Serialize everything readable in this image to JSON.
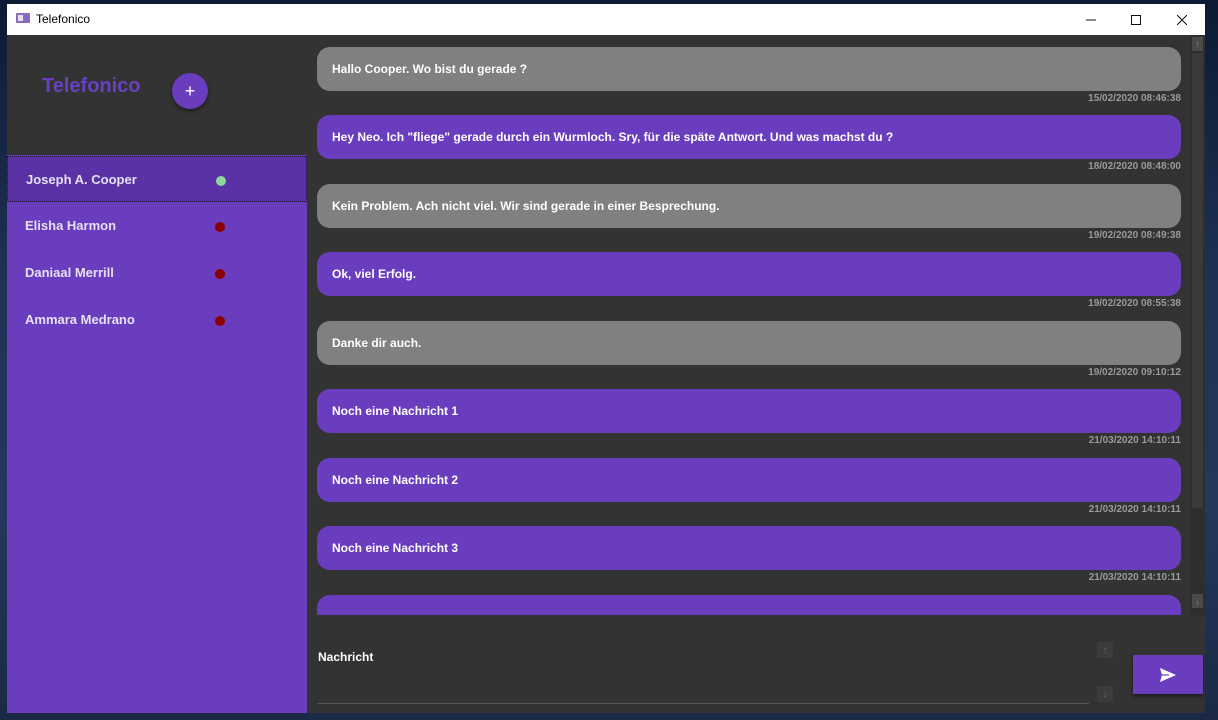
{
  "window": {
    "title": "Telefonico"
  },
  "sidebar": {
    "brand": "Telefonico",
    "add_label": "+",
    "contacts": [
      {
        "name": "Joseph A. Cooper",
        "status": "online",
        "status_color": "#8fd69a"
      },
      {
        "name": "Elisha Harmon",
        "status": "offline",
        "status_color": "#8b0000"
      },
      {
        "name": "Daniaal Merrill",
        "status": "offline",
        "status_color": "#8b0000"
      },
      {
        "name": "Ammara Medrano",
        "status": "offline",
        "status_color": "#8b0000"
      }
    ]
  },
  "messages": [
    {
      "text": "Hallo Cooper. Wo bist du gerade ?",
      "time": "15/02/2020 08:46:38",
      "style": "received"
    },
    {
      "text": "Hey Neo. Ich \"fliege\" gerade durch ein Wurmloch. Sry, für die späte Antwort. Und was machst du ?",
      "time": "18/02/2020 08:48:00",
      "style": "sent"
    },
    {
      "text": "Kein Problem. Ach nicht viel. Wir sind gerade in einer Besprechung.",
      "time": "19/02/2020 08:49:38",
      "style": "received"
    },
    {
      "text": "Ok, viel Erfolg.",
      "time": "19/02/2020 08:55:38",
      "style": "sent"
    },
    {
      "text": "Danke dir auch.",
      "time": "19/02/2020 09:10:12",
      "style": "received"
    },
    {
      "text": "Noch eine Nachricht 1",
      "time": "21/03/2020 14:10:11",
      "style": "sent"
    },
    {
      "text": "Noch eine Nachricht 2",
      "time": "21/03/2020 14:10:11",
      "style": "sent"
    },
    {
      "text": "Noch eine Nachricht 3",
      "time": "21/03/2020 14:10:11",
      "style": "sent"
    },
    {
      "text": "",
      "time": "",
      "style": "sent"
    }
  ],
  "composer": {
    "label": "Nachricht"
  },
  "colors": {
    "accent": "#6a3dbe",
    "received_bubble": "#808080",
    "brand_text": "#6a3fc2"
  }
}
